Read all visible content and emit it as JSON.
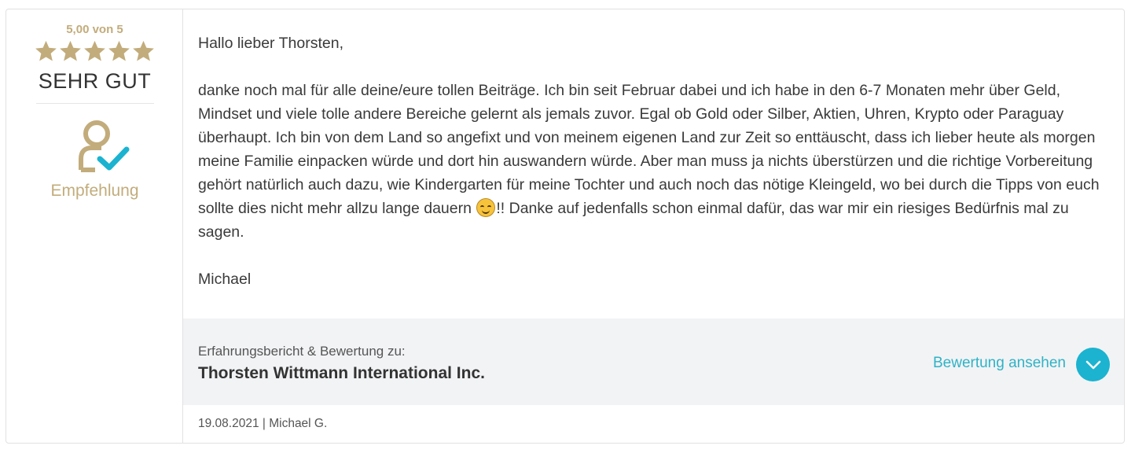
{
  "rating": {
    "score": "5,00 von 5",
    "stars": 5,
    "max_stars": 5,
    "grade": "SEHR GUT",
    "recommendation": "Empfehlung",
    "accent_color": "#c2ac7b"
  },
  "review": {
    "greeting": "Hallo lieber Thorsten,",
    "paragraph_before_emoji": "danke noch mal für alle deine/eure tollen Beiträge. Ich bin seit Februar dabei und ich habe in den 6-7 Monaten mehr über Geld, Mindset und viele tolle andere Bereiche gelernt als jemals zuvor. Egal ob Gold oder Silber, Aktien, Uhren, Krypto oder Paraguay überhaupt. Ich bin von dem Land so angefixt und von meinem eigenen Land zur Zeit so enttäuscht, dass ich lieber heute als morgen meine Familie einpacken würde und dort hin auswandern würde. Aber man muss ja nichts überstürzen und die richtige Vorbereitung gehört natürlich auch dazu, wie Kindergarten für meine Tochter und auch noch das nötige Kleingeld, wo bei durch die Tipps von euch sollte dies nicht mehr allzu lange dauern ",
    "paragraph_after_emoji": "!! Danke auf jedenfalls schon einmal dafür, das war mir ein riesiges Bedürfnis mal zu sagen.",
    "emoji": "smiling-face-emoji",
    "signature": "Michael"
  },
  "footer": {
    "caption": "Erfahrungsbericht & Bewertung zu:",
    "company": "Thorsten Wittmann International Inc.",
    "link_label": "Bewertung ansehen",
    "link_color": "#2fb3c6",
    "button_icon": "chevron-down-icon"
  },
  "meta": {
    "line": "19.08.2021 | Michael G."
  }
}
